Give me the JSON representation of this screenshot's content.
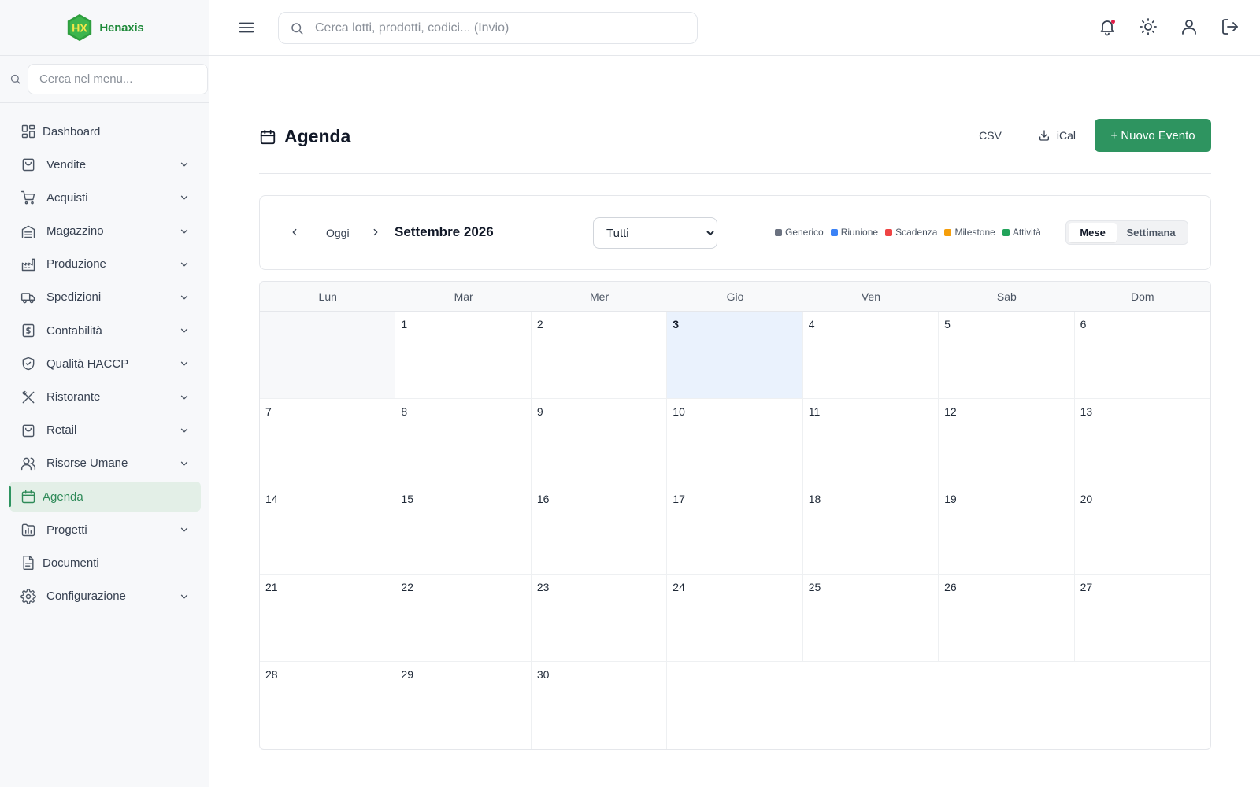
{
  "brand": {
    "name": "Henaxis",
    "logo_letters": "HX"
  },
  "sidebar": {
    "search_placeholder": "Cerca nel menu...",
    "items": [
      {
        "label": "Dashboard",
        "icon": "dashboard-icon",
        "submenu": false
      },
      {
        "label": "Vendite",
        "icon": "shopping-bag-icon",
        "submenu": true
      },
      {
        "label": "Acquisti",
        "icon": "cart-icon",
        "submenu": true
      },
      {
        "label": "Magazzino",
        "icon": "warehouse-icon",
        "submenu": true
      },
      {
        "label": "Produzione",
        "icon": "factory-icon",
        "submenu": true
      },
      {
        "label": "Spedizioni",
        "icon": "truck-icon",
        "submenu": true
      },
      {
        "label": "Contabilità",
        "icon": "dollar-icon",
        "submenu": true
      },
      {
        "label": "Qualità HACCP",
        "icon": "shield-icon",
        "submenu": true
      },
      {
        "label": "Ristorante",
        "icon": "utensils-icon",
        "submenu": true
      },
      {
        "label": "Retail",
        "icon": "shopping-bag-icon",
        "submenu": true
      },
      {
        "label": "Risorse Umane",
        "icon": "users-icon",
        "submenu": true
      },
      {
        "label": "Agenda",
        "icon": "calendar-icon",
        "submenu": false,
        "active": true
      },
      {
        "label": "Progetti",
        "icon": "chart-folder-icon",
        "submenu": true
      },
      {
        "label": "Documenti",
        "icon": "document-icon",
        "submenu": false
      },
      {
        "label": "Configurazione",
        "icon": "gear-icon",
        "submenu": true
      }
    ]
  },
  "topbar": {
    "search_placeholder": "Cerca lotti, prodotti, codici... (Invio)",
    "icons": [
      "bell-icon",
      "sun-icon",
      "user-icon",
      "logout-icon"
    ],
    "notification_dot": true
  },
  "page": {
    "title": "Agenda",
    "actions": {
      "csv": "CSV",
      "ical": "iCal",
      "new_event": "+ Nuovo Evento"
    }
  },
  "toolbar": {
    "today": "Oggi",
    "month": "Settembre 2026",
    "filter": {
      "selected": "Tutti",
      "options": [
        "Tutti"
      ]
    },
    "legend": [
      {
        "label": "Generico",
        "color": "#6b7280"
      },
      {
        "label": "Riunione",
        "color": "#3b82f6"
      },
      {
        "label": "Scadenza",
        "color": "#ef4444"
      },
      {
        "label": "Milestone",
        "color": "#f59e0b"
      },
      {
        "label": "Attività",
        "color": "#22a35a"
      }
    ],
    "views": [
      "Mese",
      "Settimana"
    ],
    "active_view": "Mese"
  },
  "calendar": {
    "weekdays": [
      "Lun",
      "Mar",
      "Mer",
      "Gio",
      "Ven",
      "Sab",
      "Dom"
    ],
    "leading_empty": 1,
    "days_in_month": 30,
    "today": 3
  },
  "colors": {
    "accent": "#2e9460",
    "today_bg": "#eaf2fd"
  }
}
